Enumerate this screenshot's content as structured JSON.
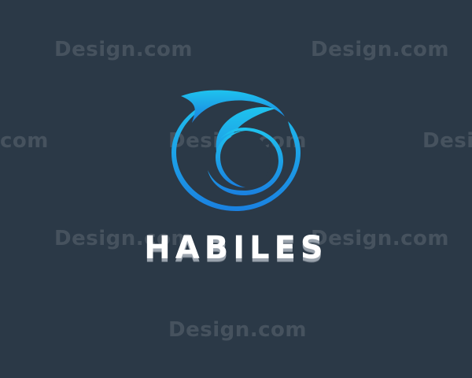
{
  "brand": {
    "name": "HABILES",
    "colors": {
      "background": "#2b3947",
      "gradient_top": "#1fc3ee",
      "gradient_bottom": "#1a80e0",
      "text": "#ffffff"
    }
  },
  "logo": {
    "icon": "swirl-circle-icon"
  },
  "watermark": {
    "text": "Design.com",
    "text_left_edge": "com",
    "text_right_edge": "Desi"
  }
}
